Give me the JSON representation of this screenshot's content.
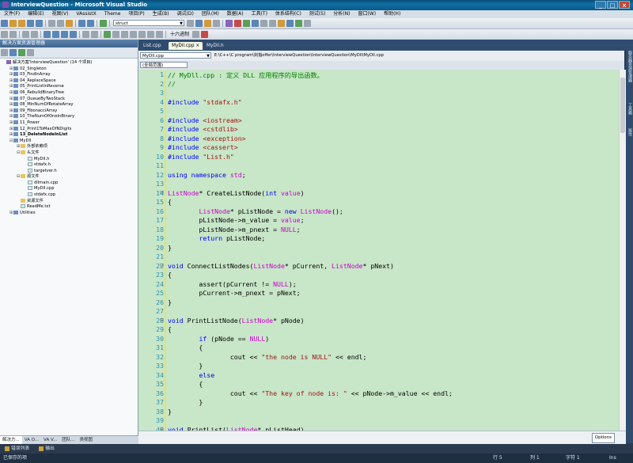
{
  "window": {
    "title": "InterviewQuestion - Microsoft Visual Studio"
  },
  "menu": [
    "文件(F)",
    "编辑(E)",
    "视图(V)",
    "VAssistX",
    "Theme",
    "项目(P)",
    "生成(B)",
    "调试(D)",
    "团队(M)",
    "数据(A)",
    "工具(T)",
    "体系结构(C)",
    "测试(S)",
    "分析(N)",
    "窗口(W)",
    "帮助(H)"
  ],
  "toolbar": {
    "find_combo": "struct",
    "hex_label": "十六进制"
  },
  "solution_explorer": {
    "title": "解决方案资源管理器",
    "items": [
      {
        "label": "解决方案'InterviewQuestion' (14 个项目)",
        "level": 0,
        "icon": "sln",
        "exp": "",
        "bold": false
      },
      {
        "label": "02_Singleton",
        "level": 1,
        "icon": "proj",
        "exp": "+",
        "bold": false
      },
      {
        "label": "03_FindInArray",
        "level": 1,
        "icon": "proj",
        "exp": "+",
        "bold": false
      },
      {
        "label": "04_ReplaceSpace",
        "level": 1,
        "icon": "proj",
        "exp": "+",
        "bold": false
      },
      {
        "label": "05_PrintListInReverse",
        "level": 1,
        "icon": "proj",
        "exp": "+",
        "bold": false
      },
      {
        "label": "06_RebuildBinaryTree",
        "level": 1,
        "icon": "proj",
        "exp": "+",
        "bold": false
      },
      {
        "label": "07_QueueByTwoStack",
        "level": 1,
        "icon": "proj",
        "exp": "+",
        "bold": false
      },
      {
        "label": "08_MinNumOfRotateArray",
        "level": 1,
        "icon": "proj",
        "exp": "+",
        "bold": false
      },
      {
        "label": "09_FibonacciArray",
        "level": 1,
        "icon": "proj",
        "exp": "+",
        "bold": false
      },
      {
        "label": "10_TheNumOfOneInBinary",
        "level": 1,
        "icon": "proj",
        "exp": "+",
        "bold": false
      },
      {
        "label": "11_Power",
        "level": 1,
        "icon": "proj",
        "exp": "+",
        "bold": false
      },
      {
        "label": "12_Print1ToMaxOfNDigits",
        "level": 1,
        "icon": "proj",
        "exp": "+",
        "bold": false
      },
      {
        "label": "13_DeleteNodeInList",
        "level": 1,
        "icon": "proj",
        "exp": "+",
        "bold": true
      },
      {
        "label": "MyDll",
        "level": 1,
        "icon": "proj",
        "exp": "-",
        "bold": false
      },
      {
        "label": "外部依赖项",
        "level": 2,
        "icon": "folder",
        "exp": "+",
        "bold": false
      },
      {
        "label": "头文件",
        "level": 2,
        "icon": "folder",
        "exp": "-",
        "bold": false
      },
      {
        "label": "MyDll.h",
        "level": 3,
        "icon": "file",
        "exp": "",
        "bold": false
      },
      {
        "label": "stdafx.h",
        "level": 3,
        "icon": "file",
        "exp": "",
        "bold": false
      },
      {
        "label": "targetver.h",
        "level": 3,
        "icon": "file",
        "exp": "",
        "bold": false
      },
      {
        "label": "源文件",
        "level": 2,
        "icon": "folder",
        "exp": "-",
        "bold": false
      },
      {
        "label": "dllmain.cpp",
        "level": 3,
        "icon": "file",
        "exp": "",
        "bold": false
      },
      {
        "label": "MyDll.cpp",
        "level": 3,
        "icon": "file",
        "exp": "",
        "bold": false
      },
      {
        "label": "stdafx.cpp",
        "level": 3,
        "icon": "file",
        "exp": "",
        "bold": false
      },
      {
        "label": "资源文件",
        "level": 2,
        "icon": "folder",
        "exp": "",
        "bold": false
      },
      {
        "label": "ReadMe.txt",
        "level": 2,
        "icon": "file",
        "exp": "",
        "bold": false
      },
      {
        "label": "Utilities",
        "level": 1,
        "icon": "proj",
        "exp": "+",
        "bold": false
      }
    ],
    "bottom_tabs": [
      "解决方...",
      "VA O...",
      "VA V...",
      "团队...",
      "类视图"
    ]
  },
  "doc_tabs": [
    "List.cpp",
    "MyDll.cpp",
    "MyDll.h"
  ],
  "nav": {
    "file_combo": "MyDll.cpp",
    "path": "E:\\C++\\C program\\剑指offer\\InterviewQuestion\\InterviewQuestion\\MyDll\\MyDll.cpp"
  },
  "scope_combo": "(全局范围)",
  "code_lines": [
    {
      "n": "1",
      "html": "<span class=\"cm\">// MyDll.cpp : 定义 DLL 应用程序的导出函数。</span>"
    },
    {
      "n": "2",
      "html": "<span class=\"cm\">//</span>"
    },
    {
      "n": "3",
      "html": ""
    },
    {
      "n": "4",
      "html": "<span class=\"pp\">#include</span> <span class=\"str\">\"stdafx.h\"</span>"
    },
    {
      "n": "5",
      "html": ""
    },
    {
      "n": "6",
      "html": "<span class=\"pp\">#include</span> <span class=\"str\">&lt;iostream&gt;</span>"
    },
    {
      "n": "7",
      "html": "<span class=\"pp\">#include</span> <span class=\"str\">&lt;cstdlib&gt;</span>"
    },
    {
      "n": "8",
      "html": "<span class=\"pp\">#include</span> <span class=\"str\">&lt;exception&gt;</span>"
    },
    {
      "n": "9",
      "html": "<span class=\"pp\">#include</span> <span class=\"str\">&lt;cassert&gt;</span>"
    },
    {
      "n": "10",
      "html": "<span class=\"pp\">#include</span> <span class=\"str\">\"List.h\"</span>"
    },
    {
      "n": "11",
      "html": ""
    },
    {
      "n": "12",
      "html": "<span class=\"kw\">using</span> <span class=\"kw\">namespace</span> <span class=\"ty\">std</span>;"
    },
    {
      "n": "13",
      "html": ""
    },
    {
      "n": "14",
      "html": "<span class=\"ty\">ListNode</span>* CreateListNode(<span class=\"kw\">int</span> <span class=\"ty\">value</span>)"
    },
    {
      "n": "15",
      "html": "{"
    },
    {
      "n": "16",
      "html": "        <span class=\"ty\">ListNode</span>* pListNode = <span class=\"kw\">new</span> <span class=\"ty\">ListNode</span>();"
    },
    {
      "n": "17",
      "html": "        pListNode-&gt;m_value = <span class=\"ty\">value</span>;"
    },
    {
      "n": "18",
      "html": "        pListNode-&gt;m_pnext = <span class=\"ty\">NULL</span>;"
    },
    {
      "n": "19",
      "html": "        <span class=\"kw\">return</span> pListNode;"
    },
    {
      "n": "20",
      "html": "}"
    },
    {
      "n": "21",
      "html": ""
    },
    {
      "n": "22",
      "html": "<span class=\"kw\">void</span> ConnectListNodes(<span class=\"ty\">ListNode</span>* pCurrent, <span class=\"ty\">ListNode</span>* pNext)"
    },
    {
      "n": "23",
      "html": "{"
    },
    {
      "n": "24",
      "html": "        assert(pCurrent != <span class=\"ty\">NULL</span>);"
    },
    {
      "n": "25",
      "html": "        pCurrent-&gt;m_pnext = pNext;"
    },
    {
      "n": "26",
      "html": "}"
    },
    {
      "n": "27",
      "html": ""
    },
    {
      "n": "28",
      "html": "<span class=\"kw\">void</span> PrintListNode(<span class=\"ty\">ListNode</span>* pNode)"
    },
    {
      "n": "29",
      "html": "{"
    },
    {
      "n": "30",
      "html": "        <span class=\"kw\">if</span> (pNode == <span class=\"ty\">NULL</span>)"
    },
    {
      "n": "31",
      "html": "        {"
    },
    {
      "n": "32",
      "html": "                cout &lt;&lt; <span class=\"str\">\"the node is NULL\"</span> &lt;&lt; endl;"
    },
    {
      "n": "33",
      "html": "        }"
    },
    {
      "n": "34",
      "html": "        <span class=\"kw\">else</span>"
    },
    {
      "n": "35",
      "html": "        {"
    },
    {
      "n": "36",
      "html": "                cout &lt;&lt; <span class=\"str\">\"The key of node is: \"</span> &lt;&lt; pNode-&gt;m_value &lt;&lt; endl;"
    },
    {
      "n": "37",
      "html": "        }"
    },
    {
      "n": "38",
      "html": "}"
    },
    {
      "n": "39",
      "html": ""
    },
    {
      "n": "40",
      "html": "<span class=\"kw\">void</span> PrintList(<span class=\"ty\">ListNode</span>* pListHead)"
    }
  ],
  "options_label": "Options",
  "right_strip_tabs": [
    "服务器资源管理器",
    "工具箱",
    "属性"
  ],
  "output_tabs": [
    "错误列表",
    "输出"
  ],
  "status": {
    "left": "已保存的项",
    "line": "行 5",
    "col": "列 1",
    "char": "字符 1",
    "mode": "Ins"
  }
}
